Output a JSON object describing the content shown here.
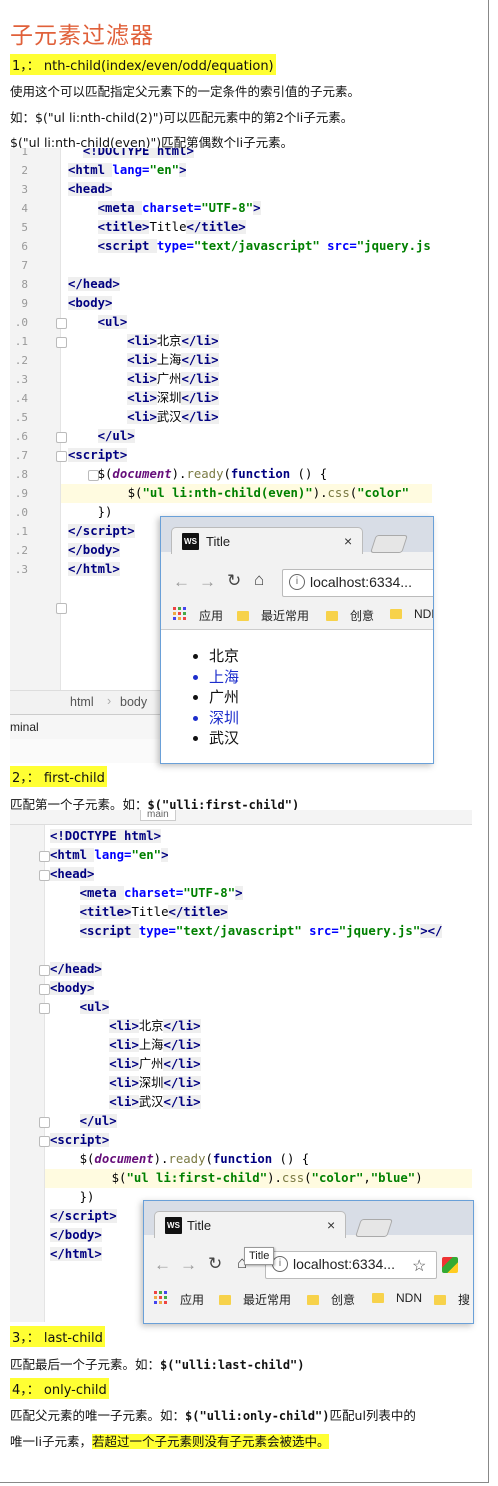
{
  "page_title": "子元素过滤器",
  "s1": {
    "heading": "1，：  nth-child(index/even/odd/equation)",
    "desc": "使用这个可以匹配指定父元素下的一定条件的索引值的子元素。",
    "ex1": "如：$(\"ul li:nth-child(2)\")可以匹配元素中的第2个li子元素。",
    "ex2": "$(\"ul li:nth-child(even)\")匹配第偶数个li子元素。"
  },
  "editor1": {
    "line_numbers": [
      "1",
      "2",
      "3",
      "4",
      "5",
      "6",
      "7",
      "8",
      "9",
      ".0",
      ".1",
      ".2",
      ".3",
      ".4",
      ".5",
      ".6",
      ".7",
      ".8",
      ".9",
      ".0",
      ".1",
      ".2",
      ".3"
    ],
    "breadcrumb": [
      "html",
      "body"
    ],
    "panel_label": "minal"
  },
  "browser1": {
    "tab_title": "Title",
    "tab_close": "×",
    "url": "localhost:6334...",
    "bookmarks": [
      "应用",
      "最近常用",
      "创意",
      "NDN"
    ],
    "list": [
      "北京",
      "上海",
      "广州",
      "深圳",
      "武汉"
    ],
    "colors": {
      "highlight": "#1d2ecc",
      "normal": "#111111"
    }
  },
  "s2": {
    "heading": "2，：  first-child",
    "desc_prefix": "匹配第一个子元素。如：",
    "desc_code": "$(\"ulli:first-child\")",
    "tab_fragment": "main"
  },
  "browser2": {
    "tab_title": "Title",
    "tab_close": "×",
    "url": "localhost:6334...",
    "tooltip": "Title",
    "bookmarks": [
      "应用",
      "最近常用",
      "创意",
      "NDN",
      "搜"
    ]
  },
  "s3": {
    "heading": "3，：  last-child",
    "desc_prefix": "匹配最后一个子元素。如：",
    "desc_code": "$(\"ulli:last-child\")"
  },
  "s4": {
    "heading": "4，：  only-child",
    "desc_prefix": "匹配父元素的唯一子元素。如：",
    "desc_code": "$(\"ulli:only-child\")",
    "desc_suffix": "匹配ul列表中的",
    "line2_plain": "唯一li子元素，",
    "line2_highlight": "若超过一个子元素则没有子元素会被选中。"
  },
  "colors": {
    "title": "#e0603a",
    "highlight": "#ffff33"
  }
}
